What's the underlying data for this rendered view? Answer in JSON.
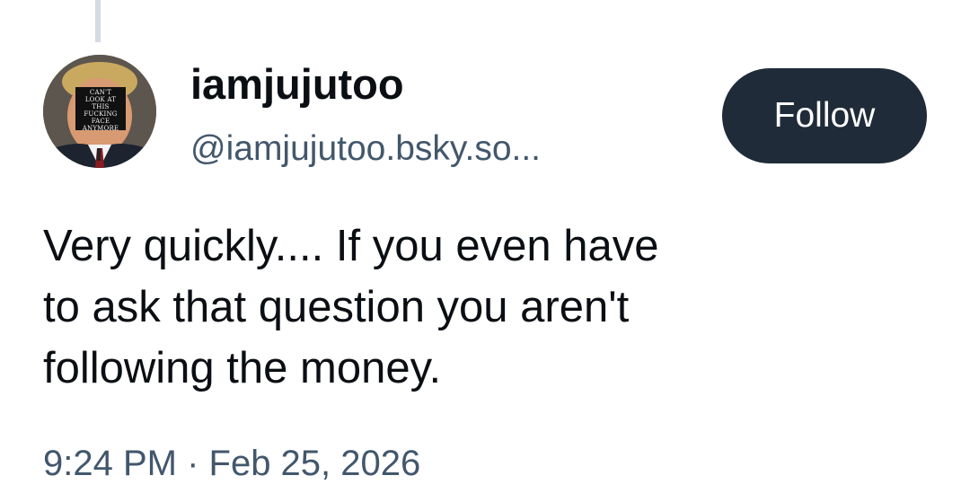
{
  "post": {
    "author": {
      "display_name": "iamjujutoo",
      "handle": "@iamjujutoo.bsky.so...",
      "avatar_caption": "CAN'T\nLOOK AT\nTHIS\nFUCKING\nFACE\nANYMORE"
    },
    "follow_label": "Follow",
    "text": "Very quickly.... If you even have\nto ask that question you aren't\nfollowing the money.",
    "timestamp": "9:24 PM · Feb 25, 2026"
  },
  "colors": {
    "follow_bg": "#1f2b38",
    "secondary_text": "#42576c",
    "thread_line": "#d4dbe2"
  }
}
